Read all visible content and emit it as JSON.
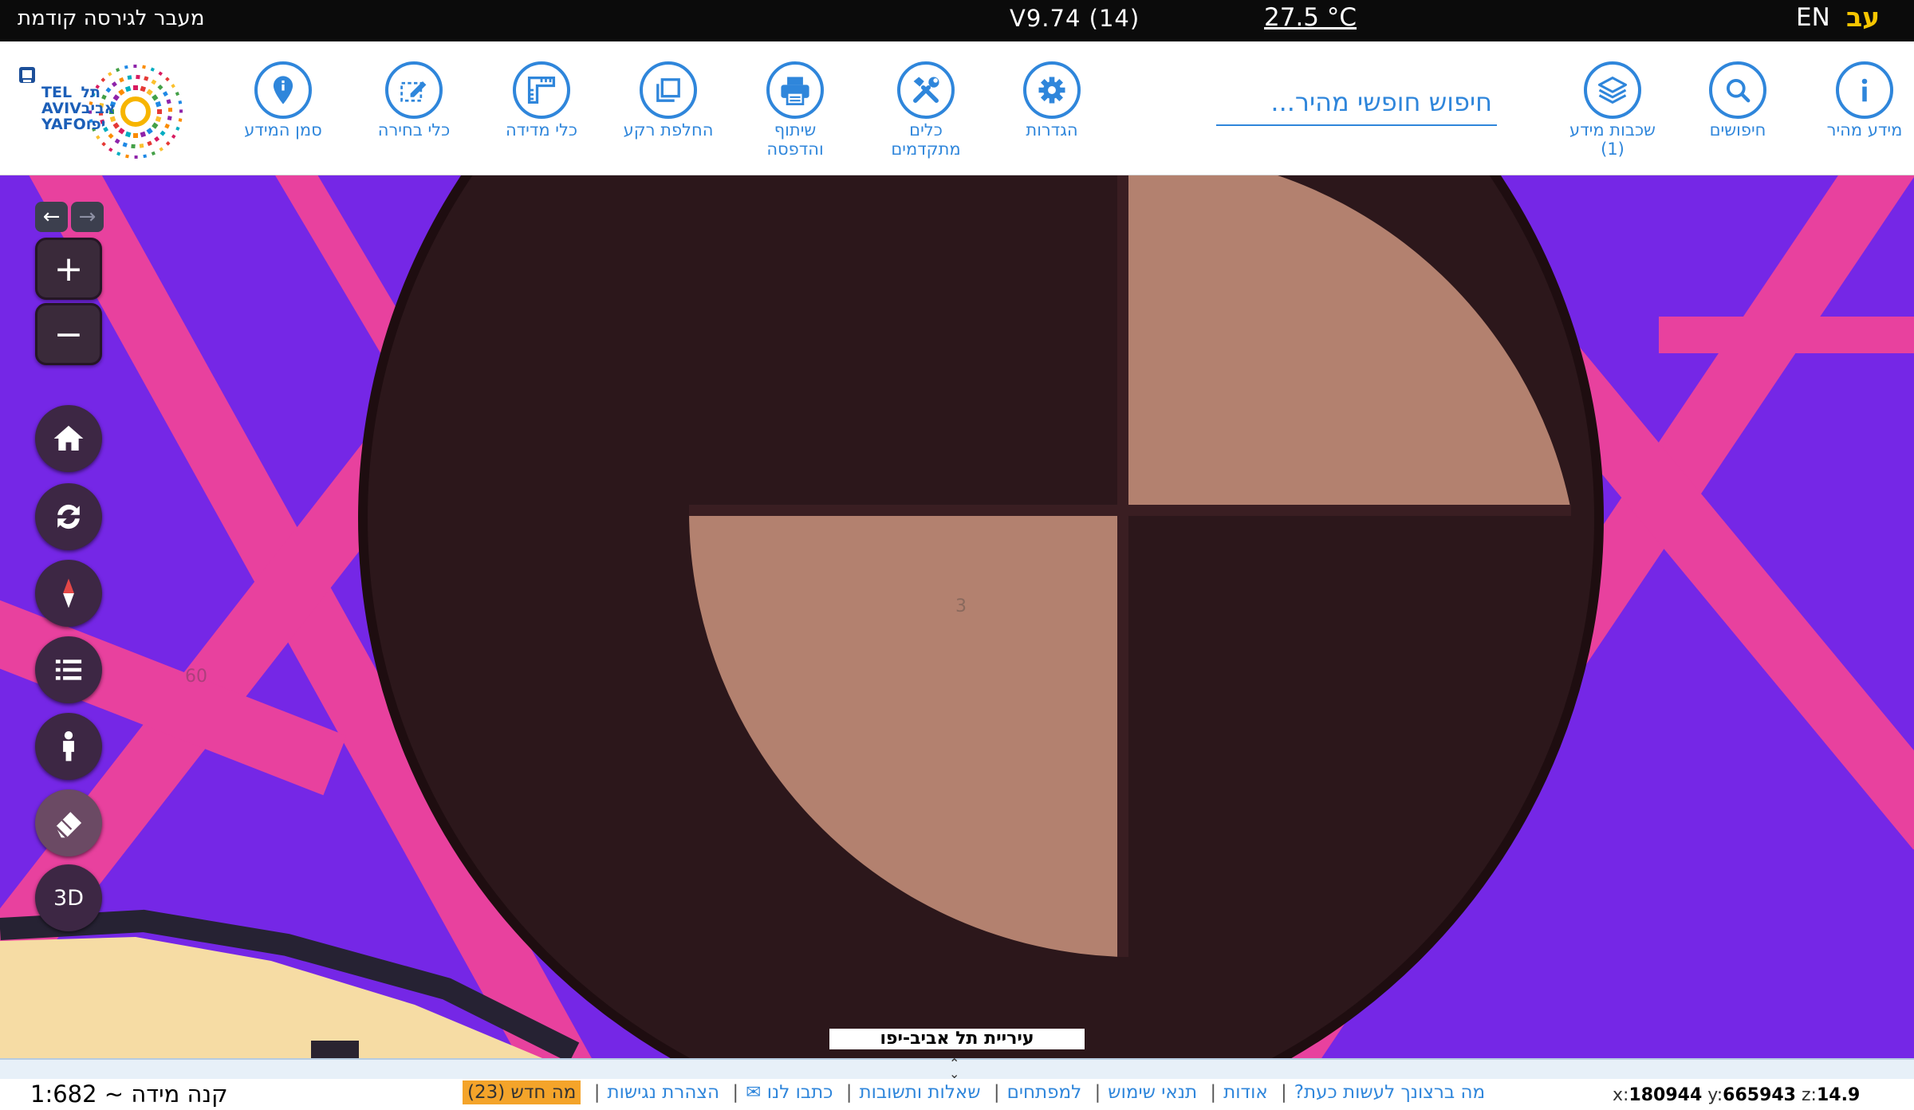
{
  "topbar": {
    "prev_version_link": "מעבר לגירסה קודמת",
    "version": "V9.74 (14)",
    "temperature": "27.5 °C",
    "lang_en": "EN",
    "lang_he": "עב"
  },
  "toolbar": {
    "quick_info": "מידע מהיר",
    "searches": "חיפושים",
    "layers_line1": "שכבות מידע",
    "layers_count": "(1)",
    "search_placeholder": "חיפוש חופשי מהיר...",
    "settings": "הגדרות",
    "advanced_line1": "כלים",
    "advanced_line2": "מתקדמים",
    "share_line1": "שיתוף",
    "share_line2": "והדפסה",
    "basemap": "החלפת רקע",
    "measure": "כלי מדידה",
    "select": "כלי בחירה",
    "marker": "סמן המידע"
  },
  "logo": {
    "text_he_top": "תל",
    "text_en_top": "TEL",
    "text_en_mid": "AVIV",
    "text_he_mid": "אביב",
    "text_en_bottom": "YAFO",
    "text_he_bottom": "יפו"
  },
  "map": {
    "label_3": "3",
    "label_60": "60",
    "city_tag": "עיריית תל אביב-יפו",
    "colors": {
      "background": "#7527e6",
      "roads": "#e8419e",
      "dark_quadrant": "#301a1d",
      "light_quadrant": "#b3816f",
      "sand": "#f6dca4"
    }
  },
  "controls": {
    "back_icon": "←",
    "forward_icon": "→",
    "zoom_in": "+",
    "zoom_out": "−",
    "three_d": "3D"
  },
  "bottom": {
    "scale": "קנה מידה ~ 1:682",
    "links": {
      "what_to_do": "מה ברצונך לעשות כעת?",
      "about": "אודות",
      "terms": "תנאי שימוש",
      "developers": "למפתחים",
      "faq": "שאלות ותשובות",
      "contact": "כתבו לנו ✉",
      "accessibility": "הצהרת נגישות",
      "whats_new": "מה חדש (23)"
    },
    "coords": {
      "x_label": "x:",
      "x_value": "180944",
      "y_label": "y:",
      "y_value": "665943",
      "z_label": "z:",
      "z_value": "14.9"
    }
  }
}
